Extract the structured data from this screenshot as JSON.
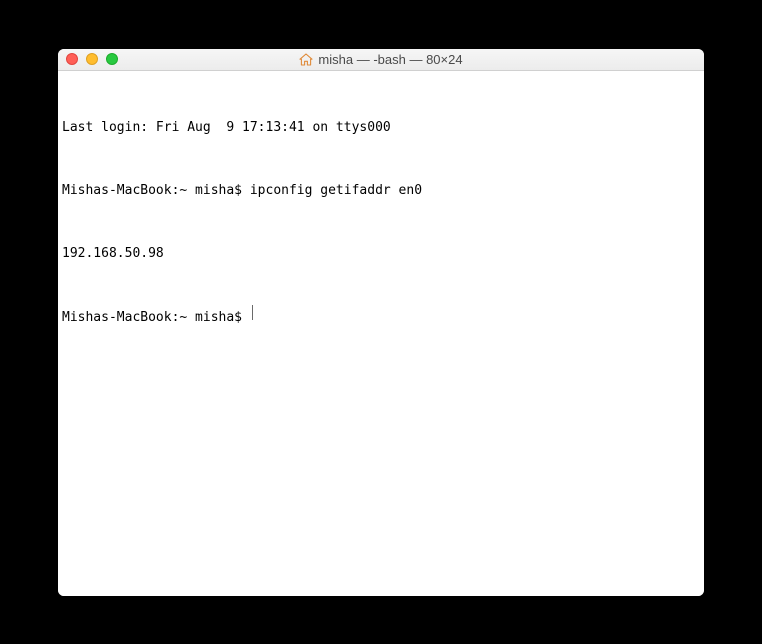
{
  "window": {
    "title": "misha — -bash — 80×24"
  },
  "terminal": {
    "last_login": "Last login: Fri Aug  9 17:13:41 on ttys000",
    "prompt1": "Mishas-MacBook:~ misha$ ",
    "command1": "ipconfig getifaddr en0",
    "output1": "192.168.50.98",
    "prompt2": "Mishas-MacBook:~ misha$ "
  }
}
